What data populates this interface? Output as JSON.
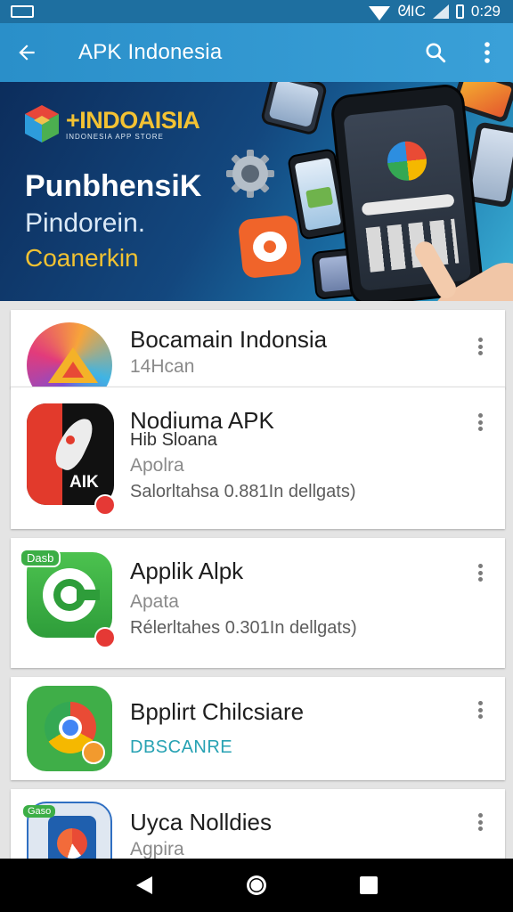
{
  "status_bar": {
    "signal_text": "ᘛIC",
    "time": "0:29"
  },
  "app_bar": {
    "title": "APK Indonesia",
    "icons": [
      "back-arrow-icon",
      "search-icon",
      "overflow-menu-icon"
    ]
  },
  "banner": {
    "brand": "+INDOAISIA",
    "tagline": "INDONESIA APP STORE",
    "line1": "PunbhensiK",
    "line2": "Pindorein.",
    "line3": "Coanerkin"
  },
  "apps": [
    {
      "name": "Bocamain Indonsia",
      "sub": "14Hcan"
    },
    {
      "name": "Nodiuma APK",
      "sub_top": "Hib Sloana",
      "sub": "Apolra",
      "stats": "Salorltahsa 0.881In dellgats)",
      "icon_text": "AIK"
    },
    {
      "name": "Applik Alpk",
      "sub": "Apata",
      "stats": "Rélerltahes 0.301In dellgats)",
      "badge_text": "Dasb"
    },
    {
      "name": "Bpplirt Chilcsiare",
      "sub": "DBSCANRE"
    },
    {
      "name": "Uyca Nolldies",
      "sub": "Agpira",
      "badge_text": "Gaso"
    }
  ],
  "colors": {
    "appbar": "#2a8fc9",
    "status": "#1e6fa0",
    "accent_yellow": "#f1c232",
    "teal_text": "#27a2b3"
  }
}
